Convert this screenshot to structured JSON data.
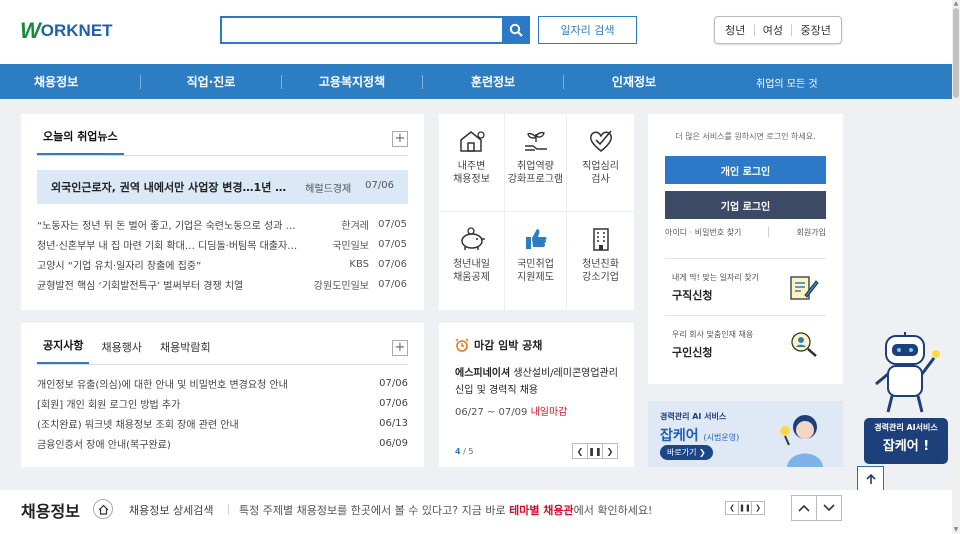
{
  "logo": {
    "mark": "W",
    "text": "ORKNET"
  },
  "search": {
    "placeholder": "",
    "job_search_label": "일자리 검색"
  },
  "age_tabs": [
    "청년",
    "여성",
    "중장년"
  ],
  "nav": {
    "items": [
      "채용정보",
      "직업·진로",
      "고용복지정책",
      "훈련정보",
      "인재정보"
    ],
    "all_label": "취업의 모든 것"
  },
  "news": {
    "tab": "오늘의 취업뉴스",
    "headline": {
      "title": "외국인근로자, 권역 내에서만 사업장 변경…1년 …",
      "source": "헤럴드경제",
      "date": "07/06"
    },
    "items": [
      {
        "title": "“노동자는 정년 뒤 돈 벌어 좋고, 기업은 숙련노동으로 성과 …",
        "source": "한겨레",
        "date": "07/05"
      },
      {
        "title": "청년·신혼부부 내 집 마련 기회 확대… 디딤돌·버팀목 대출자…",
        "source": "국민일보",
        "date": "07/05"
      },
      {
        "title": "고양시 “기업 유치·일자리 창출에 집중”",
        "source": "KBS",
        "date": "07/06"
      },
      {
        "title": "균형발전 핵심 ‘기회발전특구’ 벌써부터 경쟁 치열",
        "source": "강원도민일보",
        "date": "07/06"
      }
    ]
  },
  "notice": {
    "tabs": [
      "공지사항",
      "채용행사",
      "채용박람회"
    ],
    "items": [
      {
        "title": "개인정보 유출(의심)에 대한 안내 및 비밀번호 변경요청 안내",
        "date": "07/06"
      },
      {
        "title": "[회원] 개인 회원 로그인 방법 추가",
        "date": "07/06"
      },
      {
        "title": "(조치완료) 워크넷 채용정보 조회 장애 관련 안내",
        "date": "06/13"
      },
      {
        "title": "금융인증서 장애 안내(복구완료)",
        "date": "06/09"
      }
    ]
  },
  "services": [
    {
      "line1": "내주변",
      "line2": "채용정보",
      "icon": "house-map-icon"
    },
    {
      "line1": "취업역량",
      "line2": "강화프로그램",
      "icon": "sprout-hand-icon"
    },
    {
      "line1": "직업심리",
      "line2": "검사",
      "icon": "heart-check-icon"
    },
    {
      "line1": "청년내일",
      "line2": "채움공제",
      "icon": "piggy-bank-icon"
    },
    {
      "line1": "국민취업",
      "line2": "지원제도",
      "icon": "thumbs-up-icon"
    },
    {
      "line1": "청년친화",
      "line2": "강소기업",
      "icon": "building-icon"
    }
  ],
  "deadline": {
    "title": "마감 임박 공채",
    "company": "에스피네이셔",
    "job": "생산설비/레미콘영업관리 신입 및 경력직 채용",
    "dates": "06/27 ~ 07/09",
    "status": "내일마감",
    "page_current": "4",
    "page_total": "/ 5"
  },
  "login": {
    "message": "더 많은 서비스를 원하시면 로그인 하세요.",
    "personal_label": "개인 로그인",
    "business_label": "기업 로그인",
    "find_label": "아이디 · 비밀번호 찾기",
    "join_label": "회원가입",
    "job_apply_sub": "내게 딱! 맞는 일자리 찾기",
    "job_apply_main": "구직신청",
    "recruit_sub": "우리 회사 맞춤인재 채용",
    "recruit_main": "구인신청"
  },
  "banner": {
    "small": "경력관리 AI 서비스",
    "big": "잡케어",
    "pilot": "(시범운영)",
    "button": "바로가기 ❯"
  },
  "robot": {
    "line1": "경력관리 AI서비스",
    "line2": "잡케어 !"
  },
  "bottom": {
    "title": "채용정보",
    "detail": "채용정보 상세검색",
    "desc_pre": "특정 주제별 채용정보를 한곳에서 볼 수 있다고? 지금 바로 ",
    "desc_highlight": "테마별 채용관",
    "desc_post": "에서 확인하세요!"
  },
  "colors": {
    "brand_blue": "#2d7dc2",
    "brand_green": "#1a8b3a",
    "navy": "#3d4a66",
    "alert_red": "#d0112b"
  }
}
